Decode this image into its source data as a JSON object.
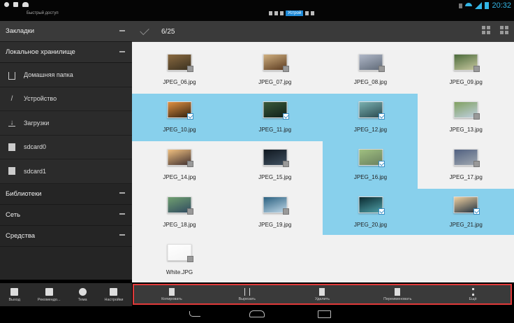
{
  "status_bar": {
    "quick_access": "Быстрый доступ",
    "highlight_label": "Устрой",
    "time": "20:32",
    "accent_color": "#33b5e5"
  },
  "sidebar": {
    "bookmarks": "Закладки",
    "local_storage": "Локальное хранилище",
    "items": [
      {
        "label": "Домашняя папка",
        "icon": "home-icon"
      },
      {
        "label": "Устройство",
        "icon": "slash-icon"
      },
      {
        "label": "Загрузки",
        "icon": "download-icon"
      },
      {
        "label": "sdcard0",
        "icon": "sdcard-icon"
      },
      {
        "label": "sdcard1",
        "icon": "sdcard-icon"
      }
    ],
    "libraries": "Библиотеки",
    "network": "Сеть",
    "tools": "Средства",
    "bottom_buttons": [
      {
        "label": "Выход",
        "icon": "exit-icon"
      },
      {
        "label": "Рекомендо...",
        "icon": "recommend-icon"
      },
      {
        "label": "Тема",
        "icon": "theme-icon"
      },
      {
        "label": "Настройки",
        "icon": "settings-icon"
      }
    ]
  },
  "header": {
    "selection_count": "6/25"
  },
  "files": [
    {
      "name": "JPEG_06.jpg",
      "selected": false,
      "colors": [
        "#8a6a40",
        "#3a3020"
      ]
    },
    {
      "name": "JPEG_07.jpg",
      "selected": false,
      "colors": [
        "#d0b080",
        "#5a3a20"
      ]
    },
    {
      "name": "JPEG_08.jpg",
      "selected": false,
      "colors": [
        "#b0b8c8",
        "#606a78"
      ]
    },
    {
      "name": "JPEG_09.jpg",
      "selected": false,
      "colors": [
        "#4a6a3a",
        "#c8c8a0"
      ]
    },
    {
      "name": "JPEG_10.jpg",
      "selected": true,
      "colors": [
        "#e09040",
        "#302010"
      ]
    },
    {
      "name": "JPEG_11.jpg",
      "selected": true,
      "colors": [
        "#3a5a3a",
        "#10201a"
      ]
    },
    {
      "name": "JPEG_12.jpg",
      "selected": true,
      "colors": [
        "#7ab0b0",
        "#2a4a50"
      ]
    },
    {
      "name": "JPEG_13.jpg",
      "selected": false,
      "colors": [
        "#80a060",
        "#c0d0e0"
      ]
    },
    {
      "name": "JPEG_14.jpg",
      "selected": false,
      "colors": [
        "#f0c080",
        "#403030"
      ]
    },
    {
      "name": "JPEG_15.jpg",
      "selected": false,
      "colors": [
        "#101820",
        "#405060"
      ]
    },
    {
      "name": "JPEG_16.jpg",
      "selected": true,
      "colors": [
        "#a0c080",
        "#6a8060"
      ]
    },
    {
      "name": "JPEG_17.jpg",
      "selected": false,
      "colors": [
        "#506080",
        "#a0a8b0"
      ]
    },
    {
      "name": "JPEG_18.jpg",
      "selected": false,
      "colors": [
        "#70a070",
        "#304a60"
      ]
    },
    {
      "name": "JPEG_19.jpg",
      "selected": false,
      "colors": [
        "#2a6080",
        "#c0d8e8"
      ]
    },
    {
      "name": "JPEG_20.jpg",
      "selected": true,
      "colors": [
        "#0a2a30",
        "#50a0a8"
      ]
    },
    {
      "name": "JPEG_21.jpg",
      "selected": true,
      "colors": [
        "#f0d0a0",
        "#203040"
      ]
    },
    {
      "name": "White.JPG",
      "selected": false,
      "colors": [
        "#ffffff",
        "#f4f4f4"
      ]
    }
  ],
  "actions": [
    {
      "label": "Копировать",
      "icon": "copy-icon"
    },
    {
      "label": "Вырезать",
      "icon": "cut-icon"
    },
    {
      "label": "Удалить",
      "icon": "delete-icon"
    },
    {
      "label": "Переименовать",
      "icon": "rename-icon"
    },
    {
      "label": "Ещё",
      "icon": "more-icon"
    }
  ]
}
